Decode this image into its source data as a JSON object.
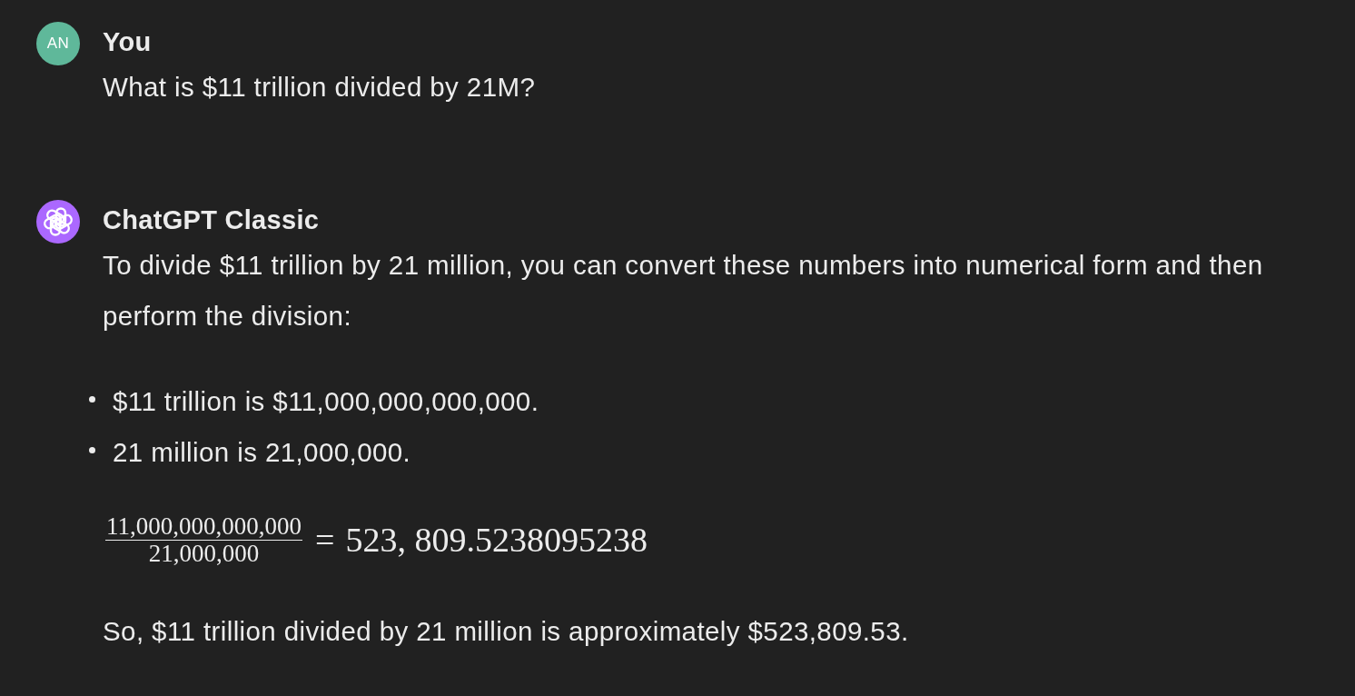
{
  "messages": [
    {
      "author": "You",
      "avatar": {
        "kind": "initials",
        "text": "AN",
        "color": "#5fb89a"
      },
      "content": [
        {
          "kind": "paragraph",
          "text": "What is $11 trillion divided by 21M?"
        }
      ]
    },
    {
      "author": "ChatGPT Classic",
      "avatar": {
        "kind": "logo",
        "color": "#ab68ff"
      },
      "content": [
        {
          "kind": "paragraph",
          "text": "To divide $11 trillion by 21 million, you can convert these numbers into numerical form and then perform the division:"
        },
        {
          "kind": "bullets",
          "items": [
            "$11 trillion is $11,000,000,000,000.",
            "21 million is 21,000,000."
          ]
        },
        {
          "kind": "equation",
          "numerator": "11,000,000,000,000",
          "denominator": "21,000,000",
          "relation": "=",
          "result": "523, 809.5238095238"
        },
        {
          "kind": "paragraph",
          "text": "So, $11 trillion divided by 21 million is approximately $523,809.53."
        }
      ]
    }
  ]
}
